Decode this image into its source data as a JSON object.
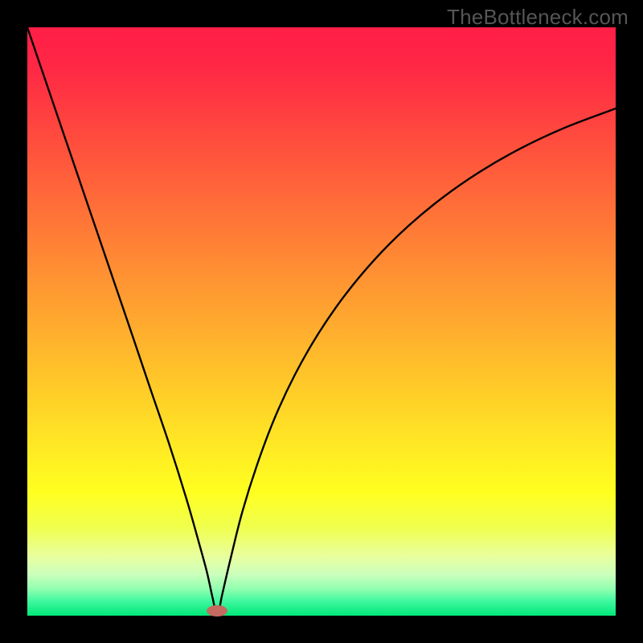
{
  "watermark": {
    "text": "TheBottleneck.com"
  },
  "gradient": {
    "stops": [
      {
        "offset": 0.0,
        "color": "#ff1e47"
      },
      {
        "offset": 0.07,
        "color": "#ff2845"
      },
      {
        "offset": 0.15,
        "color": "#ff4040"
      },
      {
        "offset": 0.23,
        "color": "#ff583c"
      },
      {
        "offset": 0.31,
        "color": "#ff7038"
      },
      {
        "offset": 0.39,
        "color": "#ff8834"
      },
      {
        "offset": 0.47,
        "color": "#ffa030"
      },
      {
        "offset": 0.55,
        "color": "#ffb82c"
      },
      {
        "offset": 0.63,
        "color": "#ffd028"
      },
      {
        "offset": 0.71,
        "color": "#ffe824"
      },
      {
        "offset": 0.79,
        "color": "#ffff20"
      },
      {
        "offset": 0.85,
        "color": "#f0ff4e"
      },
      {
        "offset": 0.9,
        "color": "#e8ffa0"
      },
      {
        "offset": 0.93,
        "color": "#caffbc"
      },
      {
        "offset": 0.955,
        "color": "#90ffb0"
      },
      {
        "offset": 0.975,
        "color": "#40f8a0"
      },
      {
        "offset": 1.0,
        "color": "#00e878"
      }
    ]
  },
  "chart_data": {
    "type": "line",
    "title": "",
    "xlabel": "",
    "ylabel": "",
    "xlim": [
      0,
      1
    ],
    "ylim": [
      0,
      1
    ],
    "optimum_x": 0.323,
    "marker": {
      "x": 0.323,
      "y": 0.005,
      "color": "#c56a60"
    },
    "curve_points": [
      {
        "x": 0.0,
        "y": 1.0
      },
      {
        "x": 0.03,
        "y": 0.912
      },
      {
        "x": 0.06,
        "y": 0.824
      },
      {
        "x": 0.09,
        "y": 0.736
      },
      {
        "x": 0.12,
        "y": 0.648
      },
      {
        "x": 0.15,
        "y": 0.56
      },
      {
        "x": 0.18,
        "y": 0.472
      },
      {
        "x": 0.21,
        "y": 0.383
      },
      {
        "x": 0.24,
        "y": 0.295
      },
      {
        "x": 0.27,
        "y": 0.2
      },
      {
        "x": 0.29,
        "y": 0.13
      },
      {
        "x": 0.305,
        "y": 0.075
      },
      {
        "x": 0.315,
        "y": 0.03
      },
      {
        "x": 0.323,
        "y": 0.0
      },
      {
        "x": 0.331,
        "y": 0.035
      },
      {
        "x": 0.345,
        "y": 0.095
      },
      {
        "x": 0.365,
        "y": 0.175
      },
      {
        "x": 0.39,
        "y": 0.255
      },
      {
        "x": 0.42,
        "y": 0.335
      },
      {
        "x": 0.455,
        "y": 0.41
      },
      {
        "x": 0.495,
        "y": 0.48
      },
      {
        "x": 0.54,
        "y": 0.545
      },
      {
        "x": 0.59,
        "y": 0.605
      },
      {
        "x": 0.645,
        "y": 0.66
      },
      {
        "x": 0.705,
        "y": 0.71
      },
      {
        "x": 0.77,
        "y": 0.755
      },
      {
        "x": 0.84,
        "y": 0.795
      },
      {
        "x": 0.915,
        "y": 0.83
      },
      {
        "x": 1.0,
        "y": 0.862
      }
    ]
  }
}
